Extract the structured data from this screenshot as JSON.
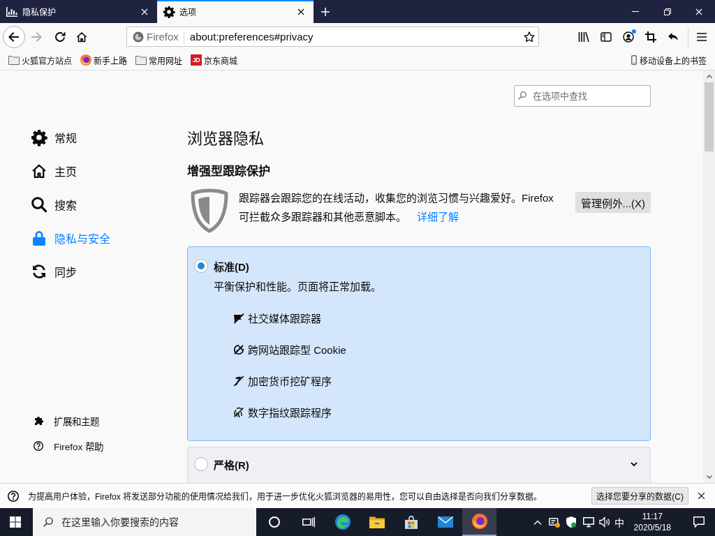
{
  "tabs": [
    {
      "label": "隐私保护",
      "selected": false
    },
    {
      "label": "选项",
      "selected": true
    }
  ],
  "navigation": {
    "forward_disabled": true,
    "identity": "Firefox",
    "url": "about:preferences#privacy",
    "account_badge": true
  },
  "bookmarks": {
    "items": [
      {
        "label": "火狐官方站点"
      },
      {
        "label": "新手上路"
      },
      {
        "label": "常用网址"
      },
      {
        "label": "京东商城",
        "logo": "JD"
      }
    ],
    "mobile": "移动设备上的书签"
  },
  "preferences": {
    "search": {
      "placeholder": "在选项中查找"
    },
    "sidebar": {
      "items": [
        {
          "label": "常规",
          "selected": false
        },
        {
          "label": "主页",
          "selected": false
        },
        {
          "label": "搜索",
          "selected": false
        },
        {
          "label": "隐私与安全",
          "selected": true
        },
        {
          "label": "同步",
          "selected": false
        }
      ],
      "footer": [
        "扩展和主题",
        "Firefox 帮助"
      ]
    },
    "title": "浏览器隐私",
    "section": "增强型跟踪保护",
    "description": "跟踪器会跟踪您的在线活动，收集您的浏览习惯与兴趣爱好。Firefox 可拦截众多跟踪器和其他恶意脚本。",
    "learn_more": "详细了解",
    "manage_button": "管理例外...(X)",
    "options": [
      {
        "label": "标准(D)",
        "selected": true,
        "expanded": true,
        "description": "平衡保护和性能。页面将正常加载。",
        "blocked": [
          "社交媒体跟踪器",
          "跨网站跟踪型 Cookie",
          "加密货币挖矿程序",
          "数字指纹跟踪程序"
        ]
      },
      {
        "label": "严格(R)",
        "selected": false,
        "expanded": false
      }
    ]
  },
  "notification": {
    "text": "为提高用户体验，Firefox 将发送部分功能的使用情况给我们，用于进一步优化火狐浏览器的易用性，您可以自由选择是否向我们分享数据。",
    "button": "选择您要分享的数据(C)"
  },
  "taskbar": {
    "search_placeholder": "在这里输入你要搜索的内容",
    "apps": [
      {
        "active": false
      },
      {
        "active": false
      },
      {
        "active": false
      },
      {
        "active": false
      },
      {
        "active": true
      }
    ],
    "input_method": "中",
    "time": "11:17",
    "date": "2020/5/18"
  }
}
